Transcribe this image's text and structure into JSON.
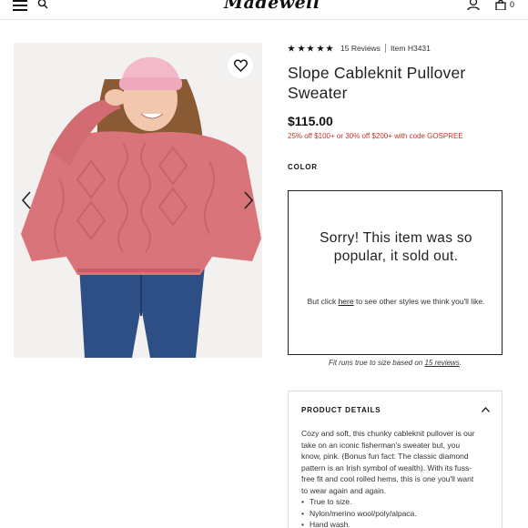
{
  "header": {
    "logo": "Madewell",
    "bag_count": "0"
  },
  "icons": {
    "menu": "hamburger-icon",
    "search": "search-icon",
    "account": "account-icon",
    "bag": "shopping-bag-icon",
    "wishlist": "heart-icon",
    "prev": "chevron-left-icon",
    "next": "chevron-right-icon",
    "collapse": "chevron-up-icon",
    "star": "star-icon"
  },
  "product": {
    "rating": 5,
    "reviews_label": "15 Reviews",
    "item_number": "Item H3431",
    "title": "Slope Cableknit Pullover Sweater",
    "price": "$115.00",
    "promo": "25% off $100+ or 30% off $200+ with code GOSPREE",
    "color_label": "COLOR"
  },
  "soldout": {
    "message": "Sorry! This item was so popular, it sold out.",
    "sub_before": "But click ",
    "sub_link": "here",
    "sub_after": " to see other styles we think you'll like."
  },
  "fit": {
    "before": "Fit runs true to size based on ",
    "link": "15 reviews",
    "after": "."
  },
  "details": {
    "header": "PRODUCT DETAILS",
    "description": "Cozy and soft, this chunky cableknit pullover is our take on an iconic fisherman's sweater but, you know, pink. (Bonus fun fact: The classic diamond pattern is an Irish symbol of wealth). With its fuss-free fit and cool rolled hems, this is one you'll want to wear again and again.",
    "bullets": [
      "True to size.",
      "Nylon/merino wool/poly/alpaca.",
      "Hand wash."
    ]
  },
  "colors": {
    "sweater": "#d9747a",
    "promo_red": "#c8312c",
    "beanie": "#f3b9c9",
    "jeans": "#2d4f86"
  }
}
